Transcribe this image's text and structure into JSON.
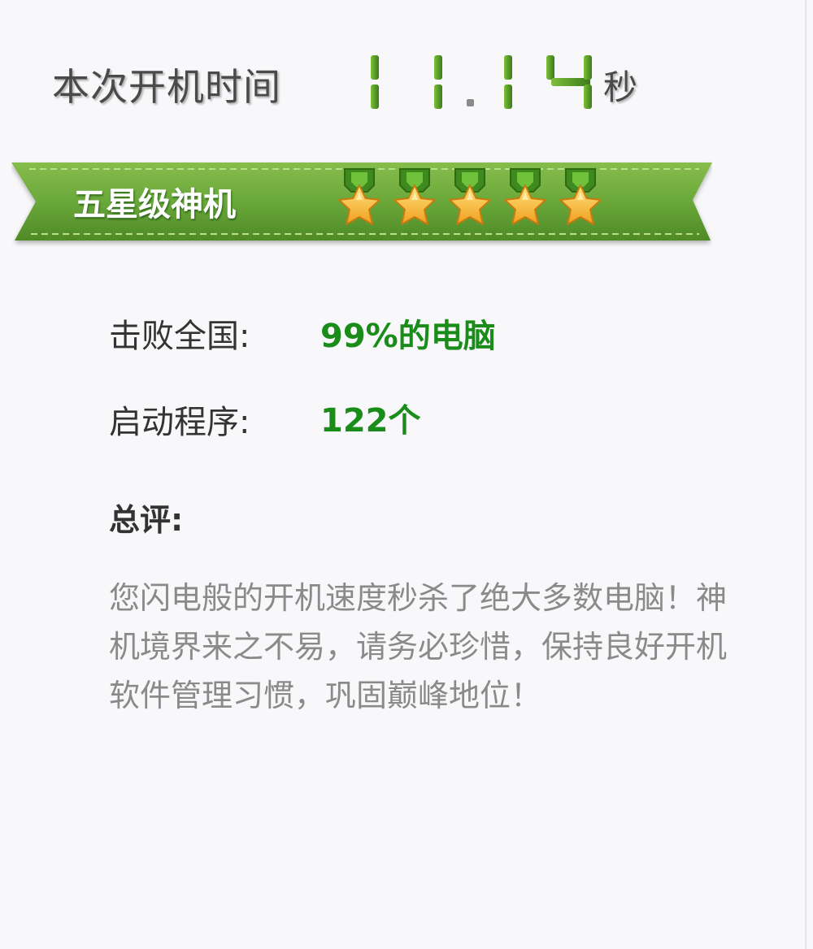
{
  "header": {
    "label": "本次开机时间",
    "seconds_value": "11.14",
    "unit": "秒"
  },
  "rating": {
    "title": "五星级神机",
    "stars": 5,
    "max_stars": 5
  },
  "stats": [
    {
      "label": "击败全国:",
      "value": "99%的电脑"
    },
    {
      "label": "启动程序:",
      "value": "122个"
    }
  ],
  "summary": {
    "title": "总评:",
    "text": "您闪电般的开机速度秒杀了绝大多数电脑！神机境界来之不易，请务必珍惜，保持良好开机软件管理习惯，巩固巅峰地位！"
  },
  "colors": {
    "digit_green": "#5a9e2a",
    "ribbon_green": "#6aa83a",
    "value_green": "#1a8c1a",
    "star_gold": "#f5b82a"
  }
}
